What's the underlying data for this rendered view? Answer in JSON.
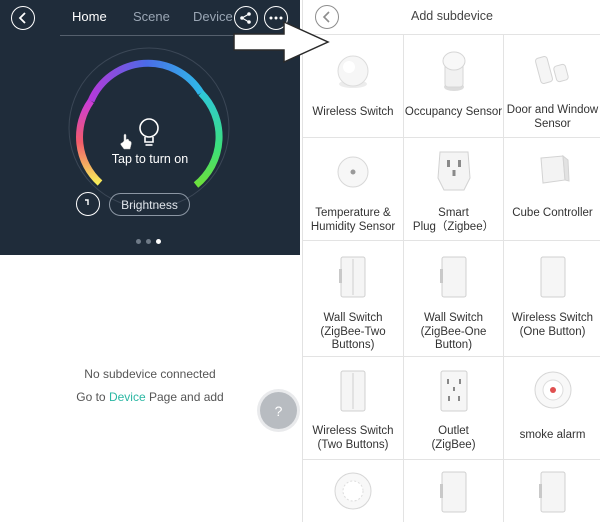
{
  "left_panel": {
    "tabs": {
      "home": "Home",
      "scene": "Scene",
      "device": "Device"
    },
    "tap_text": "Tap to turn on",
    "brightness_label": "Brightness",
    "empty_message": "No subdevice connected",
    "goto_prefix": "Go to",
    "goto_link": "Device",
    "goto_suffix": "Page and add",
    "help_label": "?",
    "page_indicator": {
      "count": 3,
      "active": 3
    }
  },
  "right_panel": {
    "title": "Add subdevice",
    "devices": [
      {
        "label": "Wireless Switch",
        "icon": "round-switch-icon"
      },
      {
        "label": "Occupancy Sensor",
        "icon": "occupancy-sensor-icon"
      },
      {
        "label": "Door and Window\nSensor",
        "icon": "door-window-sensor-icon"
      },
      {
        "label": "Temperature &\nHumidity Sensor",
        "icon": "temperature-humidity-sensor-icon"
      },
      {
        "label": "Smart\nPlug（Zigbee）",
        "icon": "smart-plug-icon"
      },
      {
        "label": "Cube Controller",
        "icon": "cube-controller-icon"
      },
      {
        "label": "Wall Switch\n(ZigBee-Two\nButtons)",
        "icon": "wall-switch-two-icon"
      },
      {
        "label": "Wall Switch\n(ZigBee-One\nButton)",
        "icon": "wall-switch-one-icon"
      },
      {
        "label": "Wireless Switch\n(One Button)",
        "icon": "wireless-switch-one-icon"
      },
      {
        "label": "Wireless Switch\n(Two Buttons)",
        "icon": "wireless-switch-two-icon"
      },
      {
        "label": "Outlet\n(ZigBee)",
        "icon": "outlet-icon"
      },
      {
        "label": "smoke alarm",
        "icon": "smoke-alarm-icon"
      },
      {
        "label": "",
        "icon": "gas-alarm-icon"
      },
      {
        "label": "",
        "icon": "wall-switch-partial-icon"
      },
      {
        "label": "",
        "icon": "wall-switch-partial-icon"
      }
    ]
  },
  "colors": {
    "dark_bg": "#1f2c3a",
    "accent": "#2bb7a3"
  }
}
